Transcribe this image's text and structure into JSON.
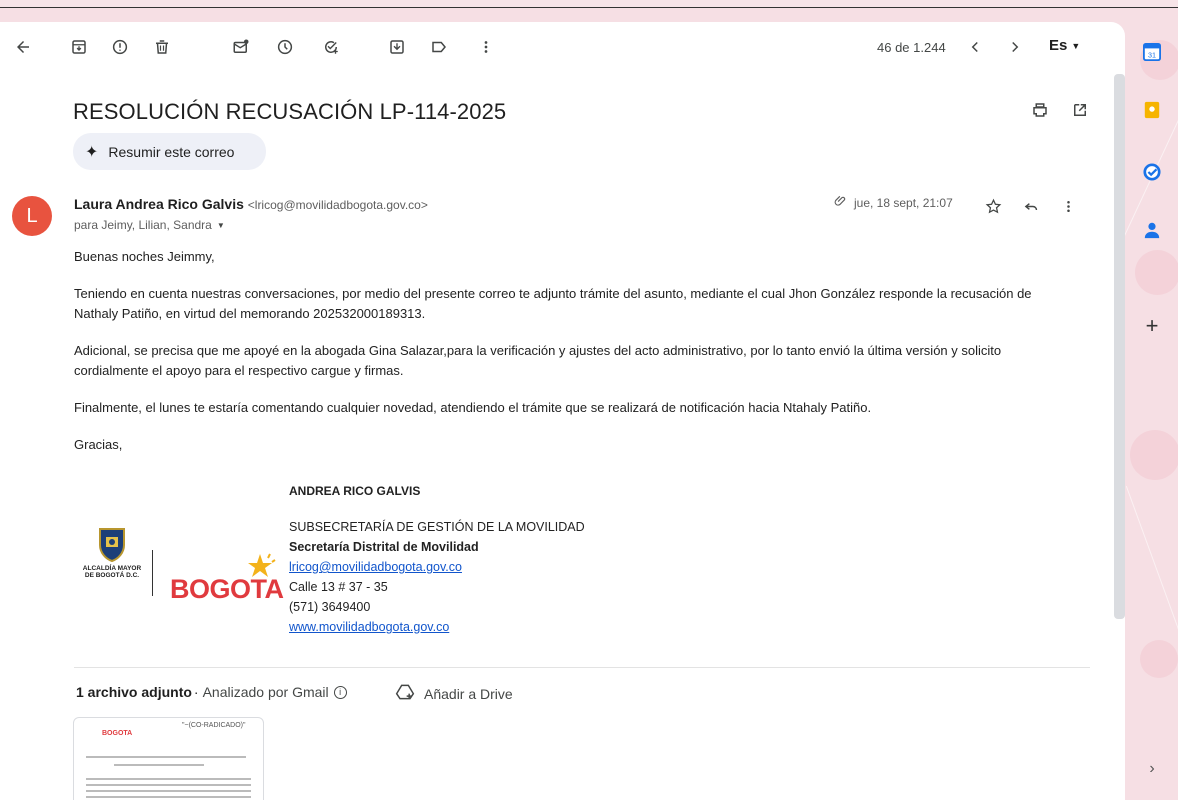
{
  "toolbar": {
    "pager": "46 de 1.244",
    "lang": "Es",
    "icons": [
      "back-arrow-icon",
      "archive-icon",
      "report-spam-icon",
      "delete-icon",
      "mark-unread-icon",
      "snooze-icon",
      "add-task-icon",
      "move-to-icon",
      "label-icon",
      "more-vert-icon",
      "prev-icon",
      "next-icon"
    ]
  },
  "email": {
    "subject": "RESOLUCIÓN RECUSACIÓN LP-114-2025",
    "summarize_label": "Resumir este correo",
    "avatar_letter": "L",
    "avatar_color": "#e8533f",
    "sender_name": "Laura Andrea Rico Galvis",
    "sender_email": "<lricog@movilidadbogota.gov.co>",
    "recipients": "para Jeimy, Lilian, Sandra",
    "date": "jue, 18 sept, 21:07",
    "body": [
      "Buenas noches Jeimmy,",
      "Teniendo en cuenta nuestras conversaciones, por medio del presente correo te adjunto trámite del asunto, mediante el cual Jhon González responde la recusación de Nathaly Patiño, en virtud del memorando 202532000189313.",
      "Adicional, se precisa que me apoyé en la abogada Gina Salazar,para la verificación y ajustes del acto administrativo, por lo tanto envió la última versión y solicito cordialmente el apoyo para el respectivo cargue y firmas.",
      "Finalmente, el lunes te estaría comentando cualquier novedad, atendiendo el trámite que se realizará de notificación hacia Ntahaly Patiño.",
      "Gracias,"
    ],
    "signature": {
      "name": "ANDREA RICO GALVIS",
      "dept": "SUBSECRETARÍA DE GESTIÓN DE LA MOVILIDAD",
      "org": "Secretaría Distrital de Movilidad",
      "email": "lricog@movilidadbogota.gov.co",
      "address": "Calle 13 # 37 - 35",
      "phone": "(571) 3649400",
      "web": "www.movilidadbogota.gov.co",
      "crest_text": "ALCALDÍA MAYOR DE BOGOTÁ D.C.",
      "logo_word": "BOGOTA"
    },
    "attachments": {
      "count_label": "1 archivo adjunto",
      "analyzed": "Analizado por Gmail",
      "drive_label": "Añadir a Drive",
      "thumb_head": "BOGOTA",
      "thumb_radicado": "\"~(CO-RADICADO)\""
    }
  },
  "colors": {
    "accent_link": "#1155cc",
    "brand_red": "#e03a3e"
  }
}
